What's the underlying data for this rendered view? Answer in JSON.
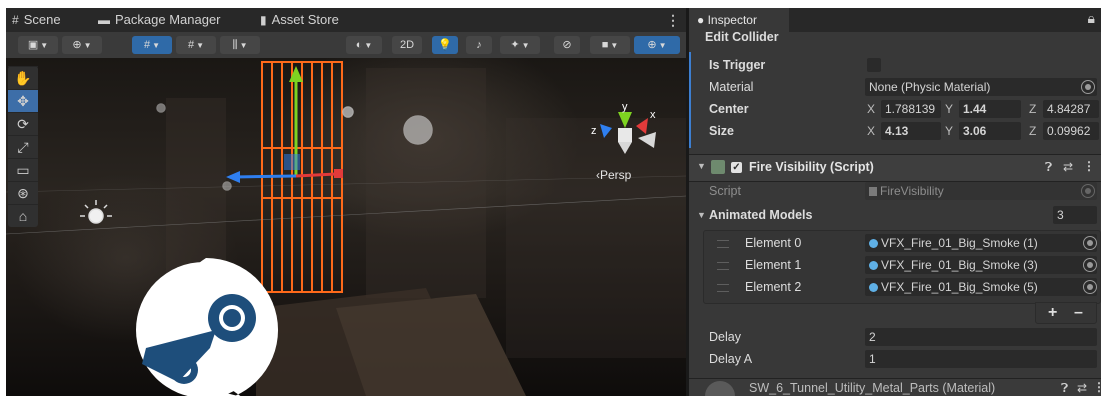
{
  "scene_tabs": [
    {
      "icon": "grid-icon",
      "label": "Scene"
    },
    {
      "icon": "package-icon",
      "label": "Package Manager"
    },
    {
      "icon": "store-bag-icon",
      "label": "Asset Store"
    }
  ],
  "scene_toolbar": {
    "toggle_2d": "2D"
  },
  "viewport": {
    "persp_label": "‹Persp"
  },
  "inspector": {
    "tab": "Inspector",
    "edit_collider": "Edit Collider",
    "is_trigger_label": "Is Trigger",
    "material_label": "Material",
    "material_value": "None (Physic Material)",
    "center_label": "Center",
    "center": {
      "x_axis": "X",
      "x": "1.788139",
      "y_axis": "Y",
      "y": "1.44",
      "z_axis": "Z",
      "z": "4.84287"
    },
    "size_label": "Size",
    "size": {
      "x_axis": "X",
      "x": "4.13",
      "y_axis": "Y",
      "y": "3.06",
      "z_axis": "Z",
      "z": "0.09962"
    },
    "component_title": "Fire Visibility (Script)",
    "script_label": "Script",
    "script_value": "FireVisibility",
    "animated_models_label": "Animated Models",
    "animated_models_count": "3",
    "elements": [
      {
        "label": "Element 0",
        "value": "VFX_Fire_01_Big_Smoke (1)"
      },
      {
        "label": "Element 1",
        "value": "VFX_Fire_01_Big_Smoke (3)"
      },
      {
        "label": "Element 2",
        "value": "VFX_Fire_01_Big_Smoke (5)"
      }
    ],
    "plus": "+",
    "minus": "–",
    "delay_label": "Delay",
    "delay_value": "2",
    "delay_a_label": "Delay A",
    "delay_a_value": "1",
    "material_component_title": "SW_6_Tunnel_Utility_Metal_Parts (Material)"
  },
  "colors": {
    "accent_blue": "#3d7fd1",
    "gizmo_y": "#7ed321",
    "gizmo_x": "#e23a3a",
    "gizmo_z": "#2f7ff0",
    "selection_orange": "#ff6a1a"
  }
}
